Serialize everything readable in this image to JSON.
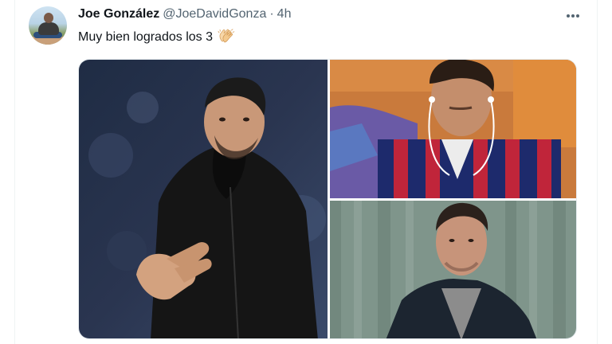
{
  "tweet": {
    "author": {
      "display_name": "Joe González",
      "handle": "@JoeDavidGonza",
      "avatar_icon": "avatar-photo"
    },
    "separator": "·",
    "timestamp": "4h",
    "text": "Muy bien logrados los 3",
    "emoji": "clapping-hands-icon",
    "more_icon": "more-options-icon",
    "media": [
      {
        "name": "photo-coach-black-jacket",
        "description_icon": "photo"
      },
      {
        "name": "photo-man-striped-shirt",
        "description_icon": "photo"
      },
      {
        "name": "photo-man-dark-jacket",
        "description_icon": "photo"
      }
    ]
  },
  "colors": {
    "text_primary": "#0f1419",
    "text_secondary": "#536471",
    "border": "#e6ecf0"
  }
}
